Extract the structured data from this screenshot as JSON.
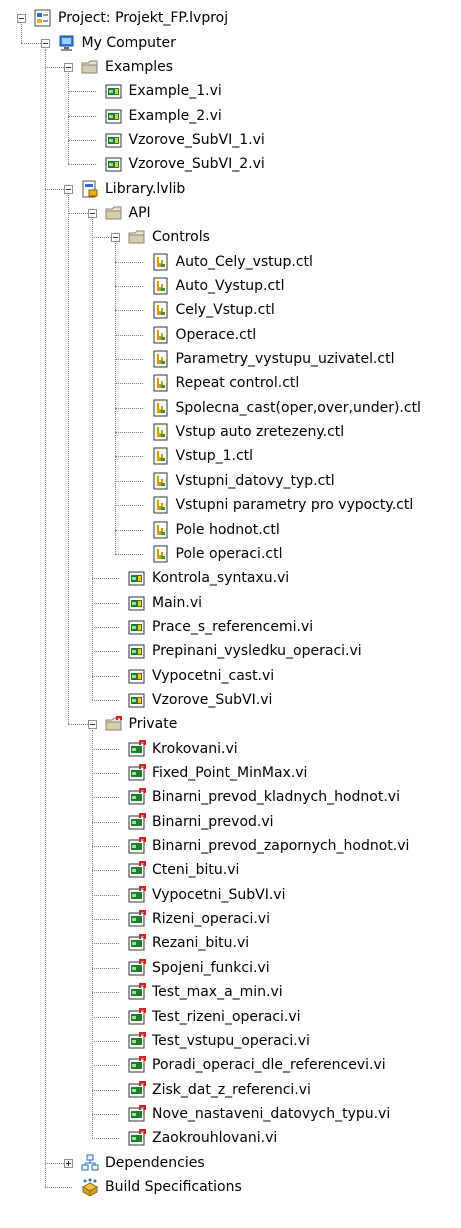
{
  "tree": {
    "nodes": [
      {
        "label": "Project: Projekt_FP.lvproj",
        "icon": "project-icon",
        "depth": 0,
        "expand": "open",
        "last": true
      },
      {
        "label": "My Computer",
        "icon": "computer-icon",
        "depth": 1,
        "expand": "open",
        "last": true
      },
      {
        "label": "Examples",
        "icon": "folder-icon",
        "depth": 2,
        "expand": "open",
        "last": false
      },
      {
        "label": "Example_1.vi",
        "icon": "vi-icon",
        "depth": 3,
        "last": false
      },
      {
        "label": "Example_2.vi",
        "icon": "vi-icon",
        "depth": 3,
        "last": false
      },
      {
        "label": "Vzorove_SubVI_1.vi",
        "icon": "vi-icon",
        "depth": 3,
        "last": false
      },
      {
        "label": "Vzorove_SubVI_2.vi",
        "icon": "vi-icon",
        "depth": 3,
        "last": true
      },
      {
        "label": "Library.lvlib",
        "icon": "library-icon",
        "depth": 2,
        "expand": "open",
        "last": false
      },
      {
        "label": "API",
        "icon": "folder-icon",
        "depth": 3,
        "expand": "open",
        "last": false
      },
      {
        "label": "Controls",
        "icon": "folder-icon",
        "depth": 4,
        "expand": "open",
        "last": false
      },
      {
        "label": "Auto_Cely_vstup.ctl",
        "icon": "ctl-icon",
        "depth": 5,
        "last": false
      },
      {
        "label": "Auto_Vystup.ctl",
        "icon": "ctl-icon",
        "depth": 5,
        "last": false
      },
      {
        "label": "Cely_Vstup.ctl",
        "icon": "ctl-icon",
        "depth": 5,
        "last": false
      },
      {
        "label": "Operace.ctl",
        "icon": "ctl-icon",
        "depth": 5,
        "last": false
      },
      {
        "label": "Parametry_vystupu_uzivatel.ctl",
        "icon": "ctl-icon",
        "depth": 5,
        "last": false
      },
      {
        "label": "Repeat control.ctl",
        "icon": "ctl-icon",
        "depth": 5,
        "last": false
      },
      {
        "label": "Spolecna_cast(oper,over,under).ctl",
        "icon": "ctl-icon",
        "depth": 5,
        "last": false
      },
      {
        "label": "Vstup auto zretezeny.ctl",
        "icon": "ctl-icon",
        "depth": 5,
        "last": false
      },
      {
        "label": "Vstup_1.ctl",
        "icon": "ctl-icon",
        "depth": 5,
        "last": false
      },
      {
        "label": "Vstupni_datovy_typ.ctl",
        "icon": "ctl-icon",
        "depth": 5,
        "last": false
      },
      {
        "label": "Vstupni parametry pro vypocty.ctl",
        "icon": "ctl-icon",
        "depth": 5,
        "last": false
      },
      {
        "label": "Pole hodnot.ctl",
        "icon": "ctl-icon",
        "depth": 5,
        "last": false
      },
      {
        "label": "Pole operaci.ctl",
        "icon": "ctl-icon",
        "depth": 5,
        "last": true
      },
      {
        "label": "Kontrola_syntaxu.vi",
        "icon": "vi-icon",
        "depth": 4,
        "last": false
      },
      {
        "label": "Main.vi",
        "icon": "vi-icon",
        "depth": 4,
        "last": false
      },
      {
        "label": "Prace_s_referencemi.vi",
        "icon": "vi-icon",
        "depth": 4,
        "last": false
      },
      {
        "label": "Prepinani_vysledku_operaci.vi",
        "icon": "vi-icon",
        "depth": 4,
        "last": false
      },
      {
        "label": "Vypocetni_cast.vi",
        "icon": "vi-icon",
        "depth": 4,
        "last": false
      },
      {
        "label": "Vzorove_SubVI.vi",
        "icon": "vi-icon",
        "depth": 4,
        "last": true
      },
      {
        "label": "Private",
        "icon": "private-folder-icon",
        "depth": 3,
        "expand": "open",
        "last": true
      },
      {
        "label": "Krokovani.vi",
        "icon": "private-vi-icon",
        "depth": 4,
        "last": false
      },
      {
        "label": "Fixed_Point_MinMax.vi",
        "icon": "private-vi-icon",
        "depth": 4,
        "last": false
      },
      {
        "label": "Binarni_prevod_kladnych_hodnot.vi",
        "icon": "private-vi-icon",
        "depth": 4,
        "last": false
      },
      {
        "label": "Binarni_prevod.vi",
        "icon": "private-vi-icon",
        "depth": 4,
        "last": false
      },
      {
        "label": "Binarni_prevod_zapornych_hodnot.vi",
        "icon": "private-vi-icon",
        "depth": 4,
        "last": false
      },
      {
        "label": "Cteni_bitu.vi",
        "icon": "private-vi-icon",
        "depth": 4,
        "last": false
      },
      {
        "label": "Vypocetni_SubVI.vi",
        "icon": "private-vi-icon",
        "depth": 4,
        "last": false
      },
      {
        "label": "Rizeni_operaci.vi",
        "icon": "private-vi-icon",
        "depth": 4,
        "last": false
      },
      {
        "label": "Rezani_bitu.vi",
        "icon": "private-vi-icon",
        "depth": 4,
        "last": false
      },
      {
        "label": "Spojeni_funkci.vi",
        "icon": "private-vi-icon",
        "depth": 4,
        "last": false
      },
      {
        "label": "Test_max_a_min.vi",
        "icon": "private-vi-icon",
        "depth": 4,
        "last": false
      },
      {
        "label": "Test_rizeni_operaci.vi",
        "icon": "private-vi-icon",
        "depth": 4,
        "last": false
      },
      {
        "label": "Test_vstupu_operaci.vi",
        "icon": "private-vi-icon",
        "depth": 4,
        "last": false
      },
      {
        "label": "Poradi_operaci_dle_referencevi.vi",
        "icon": "private-vi-icon",
        "depth": 4,
        "last": false
      },
      {
        "label": "Zisk_dat_z_referenci.vi",
        "icon": "private-vi-icon",
        "depth": 4,
        "last": false
      },
      {
        "label": "Nove_nastaveni_datovych_typu.vi",
        "icon": "private-vi-icon",
        "depth": 4,
        "last": false
      },
      {
        "label": "Zaokrouhlovani.vi",
        "icon": "private-vi-icon",
        "depth": 4,
        "last": true
      },
      {
        "label": "Dependencies",
        "icon": "dependencies-icon",
        "depth": 2,
        "expand": "closed",
        "last": false
      },
      {
        "label": "Build Specifications",
        "icon": "build-specifications-icon",
        "depth": 2,
        "last": true
      }
    ]
  }
}
